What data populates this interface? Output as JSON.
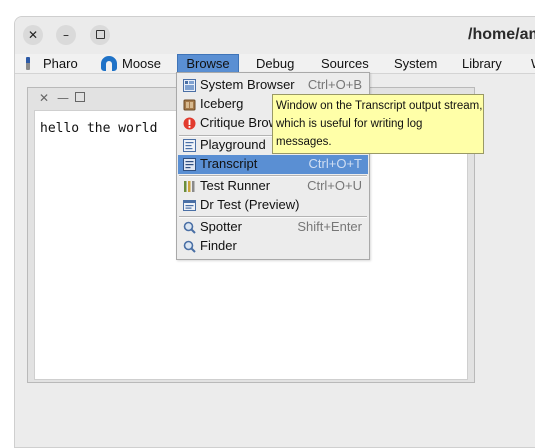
{
  "window": {
    "title": "/home/am"
  },
  "menubar": {
    "items": [
      {
        "label": "Pharo",
        "icon": "pharo-logo-icon"
      },
      {
        "label": "Moose",
        "icon": "moose-logo-icon"
      },
      {
        "label": "Browse"
      },
      {
        "label": "Debug"
      },
      {
        "label": "Sources"
      },
      {
        "label": "System"
      },
      {
        "label": "Library"
      },
      {
        "label": "W"
      }
    ],
    "active": "Browse"
  },
  "transcript": {
    "text": "hello the world"
  },
  "browse_menu": {
    "items": [
      {
        "label": "System Browser",
        "shortcut": "Ctrl+O+B",
        "icon": "system-browser-icon"
      },
      {
        "label": "Iceberg",
        "shortcut": "",
        "icon": "iceberg-icon"
      },
      {
        "label": "Critique Brow",
        "shortcut": "",
        "icon": "critique-icon"
      },
      {
        "label": "Playground",
        "shortcut": "",
        "icon": "playground-icon"
      },
      {
        "label": "Transcript",
        "shortcut": "Ctrl+O+T",
        "icon": "transcript-icon",
        "highlighted": true
      },
      {
        "label": "Test Runner",
        "shortcut": "Ctrl+O+U",
        "icon": "test-runner-icon"
      },
      {
        "label": "Dr Test (Preview)",
        "shortcut": "",
        "icon": "dr-test-icon"
      },
      {
        "label": "Spotter",
        "shortcut": "Shift+Enter",
        "icon": "spotter-icon"
      },
      {
        "label": "Finder",
        "shortcut": "",
        "icon": "finder-icon"
      }
    ]
  },
  "tooltip": {
    "lines": [
      "Window on the Transcript output stream,",
      "which is useful for writing log",
      "messages."
    ]
  },
  "colors": {
    "highlight": "#5a8fd3",
    "tooltip_bg": "#ffffa8",
    "critique_red": "#e23b2e"
  }
}
